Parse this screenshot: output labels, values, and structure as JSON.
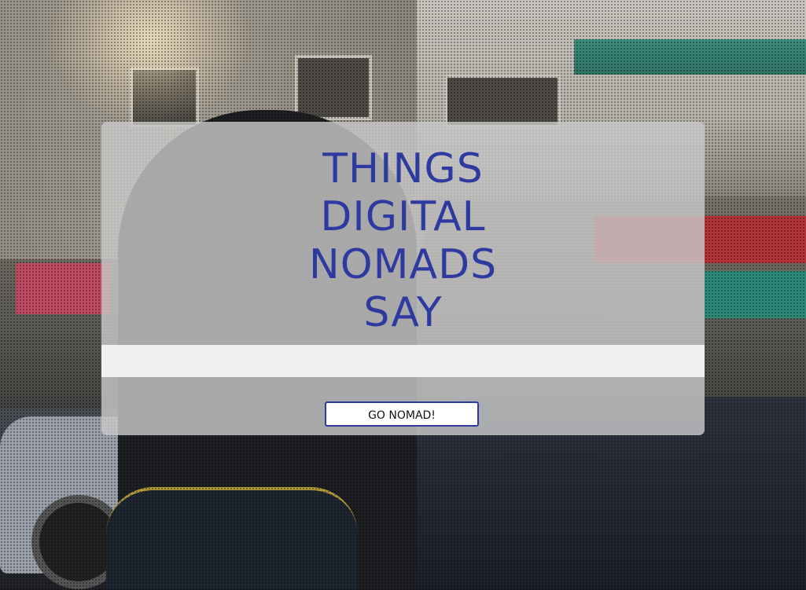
{
  "hero": {
    "title_lines": [
      "THINGS",
      "DIGITAL",
      "NOMADS",
      "SAY"
    ],
    "cta_label": "GO NOMAD!"
  },
  "colors": {
    "title": "#2e3aa0",
    "card_bg": "#c8c8c8",
    "button_border": "#2e3aa0"
  }
}
